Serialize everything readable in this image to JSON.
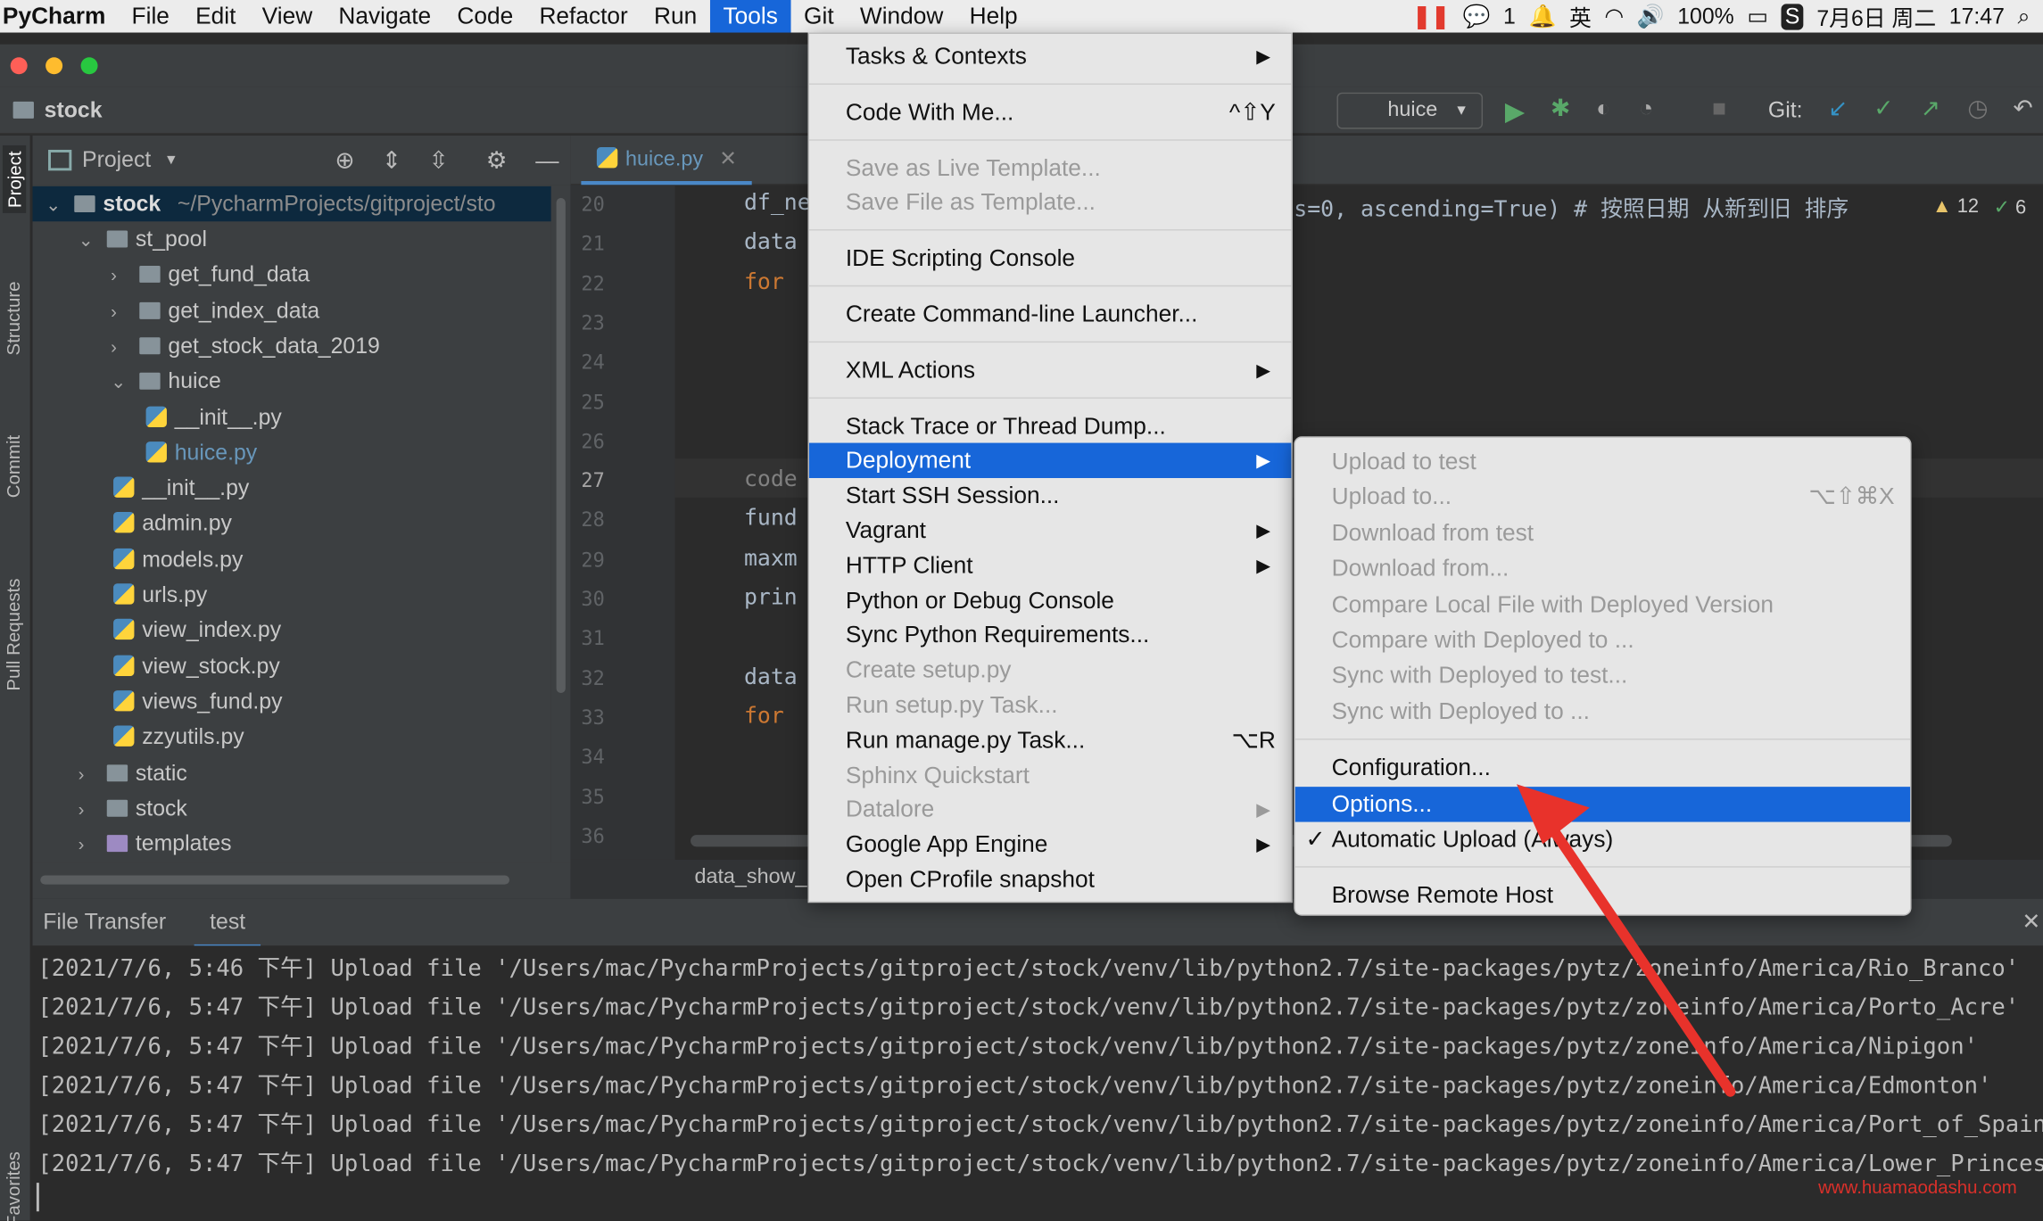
{
  "menubar": {
    "app": "PyCharm",
    "items": [
      "File",
      "Edit",
      "View",
      "Navigate",
      "Code",
      "Refactor",
      "Run",
      "Tools",
      "Git",
      "Window",
      "Help"
    ],
    "selected": "Tools"
  },
  "tray": {
    "badge": "1",
    "battery": "100%",
    "date": "7月6日 周二",
    "time": "17:47",
    "ime": "英"
  },
  "nav": {
    "project": "stock",
    "run_config": "huice",
    "git_label": "Git:"
  },
  "left_tools": [
    "Project",
    "Structure",
    "Commit",
    "Pull Requests",
    "Favorites"
  ],
  "project_panel": {
    "title": "Project",
    "root": "stock",
    "root_path": "~/PycharmProjects/gitproject/sto"
  },
  "tree": [
    {
      "label": "st_pool",
      "type": "folder",
      "depth": 1,
      "open": true
    },
    {
      "label": "get_fund_data",
      "type": "folder",
      "depth": 2,
      "open": false
    },
    {
      "label": "get_index_data",
      "type": "folder",
      "depth": 2,
      "open": false
    },
    {
      "label": "get_stock_data_2019",
      "type": "folder",
      "depth": 2,
      "open": false
    },
    {
      "label": "huice",
      "type": "folder",
      "depth": 2,
      "open": true
    },
    {
      "label": "__init__.py",
      "type": "py",
      "depth": 3
    },
    {
      "label": "huice.py",
      "type": "py",
      "depth": 3,
      "active": true
    },
    {
      "label": "__init__.py",
      "type": "py",
      "depth": 2
    },
    {
      "label": "admin.py",
      "type": "py",
      "depth": 2
    },
    {
      "label": "models.py",
      "type": "py",
      "depth": 2
    },
    {
      "label": "urls.py",
      "type": "py",
      "depth": 2
    },
    {
      "label": "view_index.py",
      "type": "py",
      "depth": 2
    },
    {
      "label": "view_stock.py",
      "type": "py",
      "depth": 2
    },
    {
      "label": "views_fund.py",
      "type": "py",
      "depth": 2
    },
    {
      "label": "zzyutils.py",
      "type": "py",
      "depth": 2
    },
    {
      "label": "static",
      "type": "folder",
      "depth": 1,
      "open": false
    },
    {
      "label": "stock",
      "type": "folder",
      "depth": 1,
      "open": false
    },
    {
      "label": "templates",
      "type": "folder-purple",
      "depth": 1,
      "open": false
    }
  ],
  "editor": {
    "tab": "huice.py",
    "line_numbers": [
      "20",
      "21",
      "22",
      "23",
      "24",
      "25",
      "26",
      "27",
      "28",
      "29",
      "30",
      "31",
      "32",
      "33",
      "34",
      "35",
      "36"
    ],
    "code_fragments": [
      "df_ne",
      "data",
      "for ",
      "",
      "",
      "",
      "",
      "code",
      "fund",
      "maxm",
      "prin",
      "",
      "data",
      "for ",
      "",
      "",
      ""
    ],
    "right_code": "s=0, ascending=True)  # 按照日期 从新到旧 排序",
    "warnings": "12",
    "oks": "6",
    "breadcrumb": "data_show_"
  },
  "tools_menu": {
    "items": [
      {
        "label": "Tasks & Contexts",
        "submenu": true
      },
      {
        "sep": true
      },
      {
        "label": "Code With Me...",
        "shortcut": "^⇧Y"
      },
      {
        "sep": true
      },
      {
        "label": "Save as Live Template...",
        "disabled": true
      },
      {
        "label": "Save File as Template...",
        "disabled": true
      },
      {
        "sep": true
      },
      {
        "label": "IDE Scripting Console"
      },
      {
        "sep": true
      },
      {
        "label": "Create Command-line Launcher..."
      },
      {
        "sep": true
      },
      {
        "label": "XML Actions",
        "submenu": true
      },
      {
        "sep": true
      },
      {
        "label": "Stack Trace or Thread Dump..."
      },
      {
        "label": "Deployment",
        "submenu": true,
        "highlight": true
      },
      {
        "label": "Start SSH Session..."
      },
      {
        "label": "Vagrant",
        "submenu": true
      },
      {
        "label": "HTTP Client",
        "submenu": true
      },
      {
        "label": "Python or Debug Console"
      },
      {
        "label": "Sync Python Requirements..."
      },
      {
        "label": "Create setup.py",
        "disabled": true
      },
      {
        "label": "Run setup.py Task...",
        "disabled": true
      },
      {
        "label": "Run manage.py Task...",
        "shortcut": "⌥R"
      },
      {
        "label": "Sphinx Quickstart",
        "disabled": true
      },
      {
        "label": "Datalore",
        "disabled": true,
        "submenu": true
      },
      {
        "label": "Google App Engine",
        "submenu": true
      },
      {
        "label": "Open CProfile snapshot"
      }
    ]
  },
  "deployment_menu": {
    "items": [
      {
        "label": "Upload to test",
        "disabled": true
      },
      {
        "label": "Upload to...",
        "disabled": true,
        "shortcut": "⌥⇧⌘X"
      },
      {
        "label": "Download from test",
        "disabled": true
      },
      {
        "label": "Download from...",
        "disabled": true
      },
      {
        "label": "Compare Local File with Deployed Version",
        "disabled": true
      },
      {
        "label": "Compare with Deployed to ...",
        "disabled": true
      },
      {
        "label": "Sync with Deployed to test...",
        "disabled": true
      },
      {
        "label": "Sync with Deployed to ...",
        "disabled": true
      },
      {
        "sep": true
      },
      {
        "label": "Configuration..."
      },
      {
        "label": "Options...",
        "highlight": true
      },
      {
        "label": "Automatic Upload (Always)",
        "checked": true
      },
      {
        "sep": true
      },
      {
        "label": "Browse Remote Host"
      }
    ]
  },
  "bottom": {
    "tabs": [
      "File Transfer",
      "test"
    ],
    "active": "test"
  },
  "console_lines": [
    "[2021/7/6, 5:46 下午] Upload file '/Users/mac/PycharmProjects/gitproject/stock/venv/lib/python2.7/site-packages/pytz/zoneinfo/America/Rio_Branco'",
    "[2021/7/6, 5:47 下午] Upload file '/Users/mac/PycharmProjects/gitproject/stock/venv/lib/python2.7/site-packages/pytz/zoneinfo/America/Porto_Acre'",
    "[2021/7/6, 5:47 下午] Upload file '/Users/mac/PycharmProjects/gitproject/stock/venv/lib/python2.7/site-packages/pytz/zoneinfo/America/Nipigon'",
    "[2021/7/6, 5:47 下午] Upload file '/Users/mac/PycharmProjects/gitproject/stock/venv/lib/python2.7/site-packages/pytz/zoneinfo/America/Edmonton'",
    "[2021/7/6, 5:47 下午] Upload file '/Users/mac/PycharmProjects/gitproject/stock/venv/lib/python2.7/site-packages/pytz/zoneinfo/America/Port_of_Spain'",
    "[2021/7/6, 5:47 下午] Upload file '/Users/mac/PycharmProjects/gitproject/stock/venv/lib/python2.7/site-packages/pytz/zoneinfo/America/Lower_Princes'"
  ],
  "watermark": "www.huamaodashu.com",
  "colors": {
    "accent": "#1766d9",
    "annotation_arrow": "#e8322b"
  }
}
